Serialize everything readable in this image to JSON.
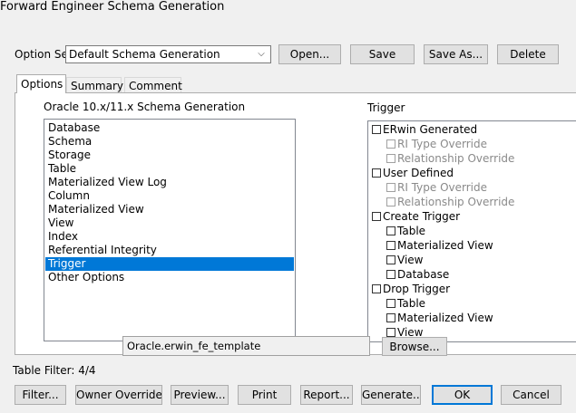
{
  "window": {
    "title": "Forward Engineer Schema Generation"
  },
  "option_set": {
    "label": "Option Set:",
    "value": "Default Schema Generation",
    "open_label": "Open...",
    "save_label": "Save",
    "save_as_label": "Save As...",
    "delete_label": "Delete"
  },
  "tabs": [
    {
      "label": "Options"
    },
    {
      "label": "Summary"
    },
    {
      "label": "Comment"
    }
  ],
  "left": {
    "heading": "Oracle 10.x/11.x Schema Generation",
    "items": [
      {
        "label": "Database"
      },
      {
        "label": "Schema"
      },
      {
        "label": "Storage"
      },
      {
        "label": "Table"
      },
      {
        "label": "Materialized View Log"
      },
      {
        "label": "Column"
      },
      {
        "label": "Materialized View"
      },
      {
        "label": "View"
      },
      {
        "label": "Index"
      },
      {
        "label": "Referential Integrity"
      },
      {
        "label": "Trigger"
      },
      {
        "label": "Other Options"
      }
    ],
    "selected": "Trigger"
  },
  "right": {
    "heading": "Trigger",
    "nodes": [
      {
        "label": "ERwin Generated",
        "checked": false,
        "enabled": true
      },
      {
        "label": "RI Type Override",
        "checked": false,
        "enabled": false
      },
      {
        "label": "Relationship Override",
        "checked": false,
        "enabled": false
      },
      {
        "label": "User Defined",
        "checked": false,
        "enabled": true
      },
      {
        "label": "RI Type Override",
        "checked": false,
        "enabled": false
      },
      {
        "label": "Relationship Override",
        "checked": false,
        "enabled": false
      },
      {
        "label": "Create Trigger",
        "checked": false,
        "enabled": true
      },
      {
        "label": "Table",
        "checked": false,
        "enabled": true
      },
      {
        "label": "Materialized View",
        "checked": false,
        "enabled": true
      },
      {
        "label": "View",
        "checked": false,
        "enabled": true
      },
      {
        "label": "Database",
        "checked": false,
        "enabled": true
      },
      {
        "label": "Drop Trigger",
        "checked": false,
        "enabled": true
      },
      {
        "label": "Table",
        "checked": false,
        "enabled": true
      },
      {
        "label": "Materialized View",
        "checked": false,
        "enabled": true
      },
      {
        "label": "View",
        "checked": false,
        "enabled": true
      }
    ]
  },
  "template": {
    "value": "Oracle.erwin_fe_template",
    "browse_label": "Browse..."
  },
  "status": {
    "table_filter": "Table Filter: 4/4"
  },
  "footer": {
    "filter_label": "Filter...",
    "owner_override_label": "Owner Override...",
    "preview_label": "Preview...",
    "print_label": "Print",
    "report_label": "Report...",
    "generate_label": "Generate...",
    "ok_label": "OK",
    "cancel_label": "Cancel"
  },
  "colors": {
    "selection": "#0078d7",
    "default_button_border": "#0078d7",
    "dialog_bg": "#f0f0f0"
  }
}
